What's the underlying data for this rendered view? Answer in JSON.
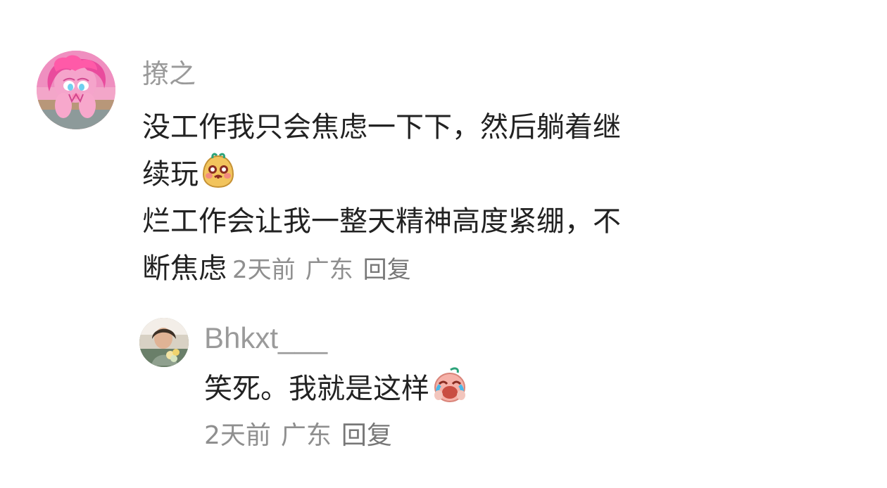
{
  "comments": [
    {
      "user": "撩之",
      "text_line_1": "没工作我只会焦虑一下下，然后躺着继",
      "text_line_2": "续玩",
      "text_line_3": "烂工作会让我一整天精神高度紧绷，不",
      "text_line_4": "断焦虑",
      "time": "2天前",
      "location": "广东",
      "reply_label": "回复",
      "emoji_name": "sweet-potato-smile-emoji",
      "avatar_name": "pink-pony-avatar"
    },
    {
      "user": "Bhkxt___",
      "text": "笑死。我就是这样",
      "time": "2天前",
      "location": "广东",
      "reply_label": "回复",
      "emoji_name": "laugh-cry-emoji",
      "avatar_name": "user-photo-avatar"
    }
  ],
  "colors": {
    "text_primary": "#222222",
    "text_secondary": "#8f8f8f",
    "username": "#9a9a9a",
    "background": "#ffffff"
  }
}
